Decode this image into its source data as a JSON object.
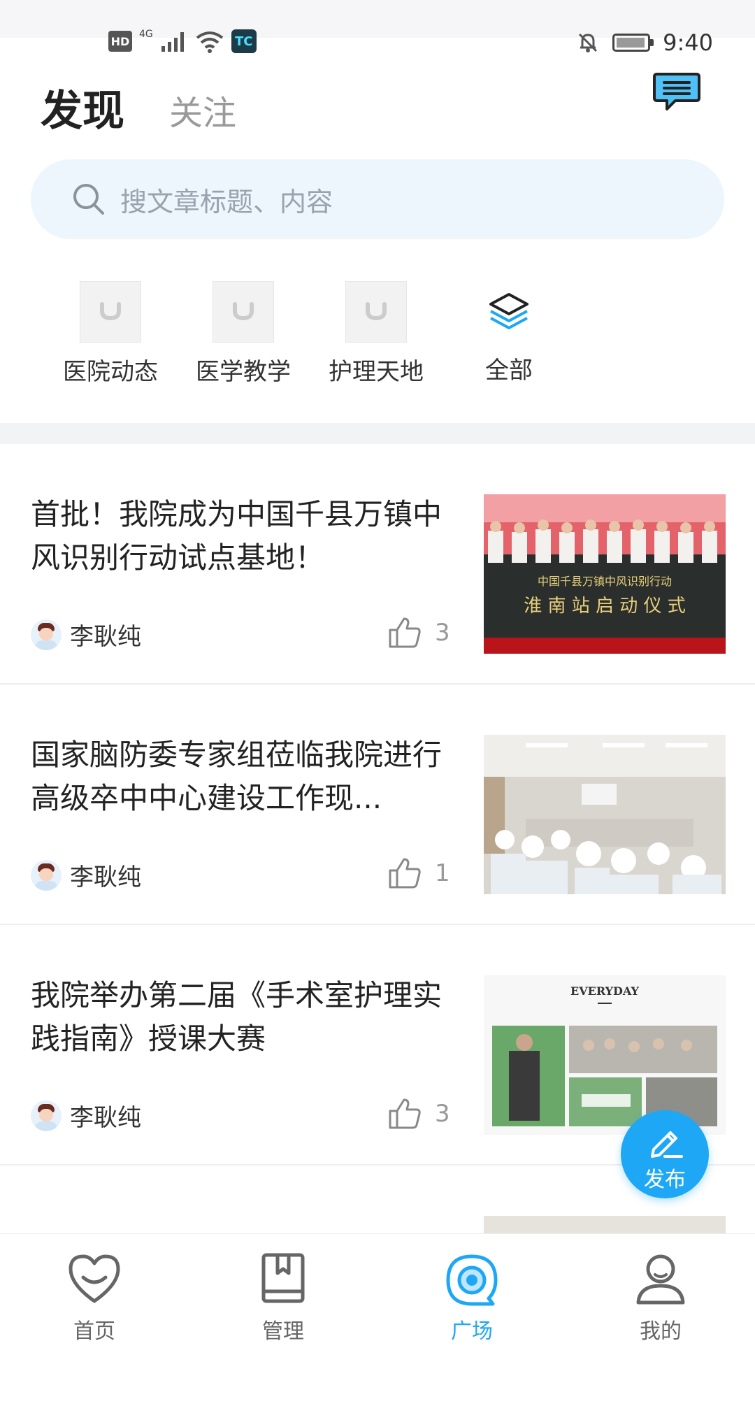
{
  "status_bar": {
    "hd": "HD",
    "network": "4G",
    "app_badge": "TC",
    "time": "9:40",
    "icons": [
      "hd-icon",
      "signal-icon",
      "wifi-icon",
      "tc-app-icon",
      "mute-icon",
      "battery-icon"
    ]
  },
  "header": {
    "tab_active": "发现",
    "tab_inactive": "关注",
    "message_icon": "message-icon"
  },
  "search": {
    "placeholder": "搜文章标题、内容"
  },
  "categories": [
    {
      "label": "医院动态"
    },
    {
      "label": "医学教学"
    },
    {
      "label": "护理天地"
    },
    {
      "label": "全部"
    }
  ],
  "articles": [
    {
      "title": "首批！我院成为中国千县万镇中风识别行动试点基地！",
      "author": "李耿纯",
      "likes": "3",
      "photo_banner": "中国千县万镇中风识别行动",
      "photo_banner2": "淮 南 站 启 动 仪 式"
    },
    {
      "title": "国家脑防委专家组莅临我院进行高级卒中中心建设工作现...",
      "author": "李耿纯",
      "likes": "1"
    },
    {
      "title": "我院举办第二届《手术室护理实践指南》授课大赛",
      "author": "李耿纯",
      "likes": "3",
      "photo_caption": "EVERYDAY"
    }
  ],
  "fab": {
    "label": "发布"
  },
  "bottom_nav": [
    {
      "label": "首页",
      "active": false
    },
    {
      "label": "管理",
      "active": false
    },
    {
      "label": "广场",
      "active": true
    },
    {
      "label": "我的",
      "active": false
    }
  ],
  "colors": {
    "accent": "#1ea7f5",
    "search_bg": "#edf5fd",
    "inactive_text": "#999999"
  }
}
